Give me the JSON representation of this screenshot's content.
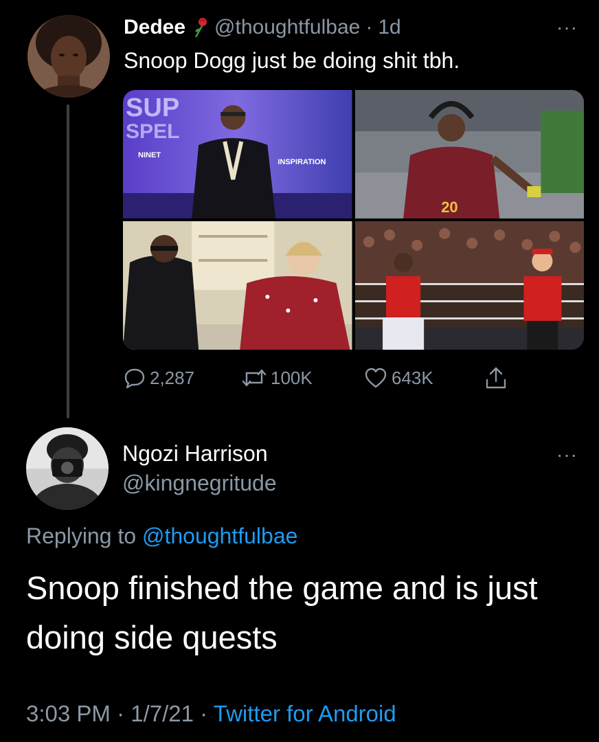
{
  "tweet": {
    "author_name": "Dedee",
    "author_handle": "@thoughtfulbae",
    "separator": "·",
    "time": "1d",
    "text": "Snoop Dogg just be doing shit tbh.",
    "media": [
      {
        "icon": "photo-gospel-stage"
      },
      {
        "icon": "photo-football-game"
      },
      {
        "icon": "photo-cooking-show"
      },
      {
        "icon": "photo-wrestling-ring"
      }
    ],
    "actions": {
      "replies": "2,287",
      "retweets": "100K",
      "likes": "643K"
    },
    "more_label": "···"
  },
  "reply": {
    "author_name": "Ngozi Harrison",
    "author_handle": "@kingnegritude",
    "replying_prefix": "Replying to",
    "replying_to": "@thoughtfulbae",
    "text": "Snoop finished the game and is just doing side quests",
    "time": "3:03 PM",
    "date": "1/7/21",
    "dot": "·",
    "source": "Twitter for Android",
    "more_label": "···"
  },
  "colors": {
    "background": "#000000",
    "muted": "#8b98a5",
    "link": "#1d9bf0"
  }
}
